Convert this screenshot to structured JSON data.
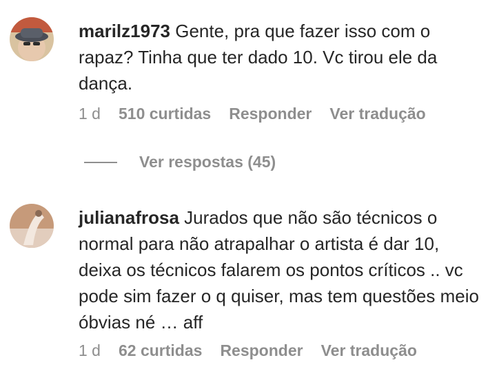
{
  "comments": [
    {
      "username": "marilz1973",
      "text": "Gente, pra que fazer isso com o rapaz? Tinha que ter dado 10. Vc tirou ele da dança.",
      "age": "1 d",
      "likes": "510 curtidas",
      "reply_label": "Responder",
      "translate_label": "Ver tradução"
    },
    {
      "username": "julianafrosa",
      "text": "Jurados que não são técnicos o normal para não atrapalhar o artista é dar 10, deixa os técnicos falarem os pontos críticos .. vc pode sim fazer o q quiser, mas tem questões meio óbvias né … aff",
      "age": "1 d",
      "likes": "62 curtidas",
      "reply_label": "Responder",
      "translate_label": "Ver tradução"
    }
  ],
  "view_replies_label": "Ver respostas (45)",
  "colors": {
    "text": "#262626",
    "muted": "#8e8e8e"
  }
}
